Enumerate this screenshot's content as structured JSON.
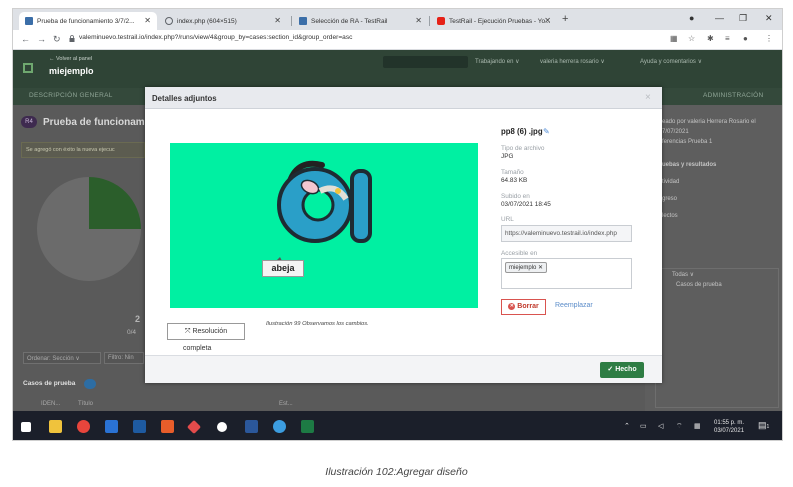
{
  "browser": {
    "tabs": [
      {
        "title": "Prueba de funcionamiento 3/7/2...",
        "favicon_color": "#3b6ea8"
      },
      {
        "title": "index.php (604×515)",
        "favicon_color": "#5f6368"
      },
      {
        "title": "Selección de RA - TestRail",
        "favicon_color": "#3b6ea8"
      },
      {
        "title": "TestRail - Ejecución Pruebas - Yo...",
        "favicon_color": "#e62117"
      }
    ],
    "new_tab": "+",
    "url": "valeminuevo.testrail.io/index.php?/runs/view/4&group_by=cases:section_id&group_order=asc"
  },
  "app": {
    "back_link": "← Volver al panel",
    "project": "miejemplo",
    "header_items": [
      "Trabajando en ∨",
      "valeria herrera rosario ∨",
      "Ayuda y comentarios ∨"
    ],
    "nav": [
      "DESCRIPCIÓN GENERAL",
      "ADMINISTRACIÓN"
    ],
    "run_title": "Prueba de funcionam",
    "run_badge": "R4",
    "success_msg": "Se agregó con éxito la nueva ejecuc",
    "pie_number": "2",
    "pie_sub": "0/4",
    "ordenar": "Ordenar: Sección ∨",
    "filtro": "Filtro: Nin",
    "cases_title": "Casos de prueba",
    "col_id": "IDEN...",
    "col_title": "Título",
    "col_est": "Est...",
    "right_text": [
      "eado por valeria Herrera Rosario el",
      "7/07/2021",
      "ferencias Prueba 1"
    ],
    "right_heading": "uebas y resultados",
    "right_links": [
      "tividad",
      "greso",
      "lectos"
    ],
    "tree_label": "Todas ∨",
    "tree_item": "Casos de prueba"
  },
  "modal": {
    "title": "Detalles adjuntos",
    "close": "×",
    "image_label": "abeja",
    "resolution_button": "Resolución",
    "resolution_second_line": "completa",
    "caption": "Ilustración 99 Observamos los cambios.",
    "filename": "pp8 (6) .jpg",
    "file_type_label": "Tipo de archivo",
    "file_type": "JPG",
    "size_label": "Tamaño",
    "size": "64.83 KB",
    "uploaded_label": "Subido en",
    "uploaded": "03/07/2021 18:45",
    "url_label": "URL",
    "url": "https://valeminuevo.testrail.io/index.php",
    "access_label": "Accesible en",
    "access_chip": "miejemplo",
    "delete_button": "Borrar",
    "replace_link": "Reemplazar",
    "done_button": "Hecho"
  },
  "taskbar": {
    "time": "01:55 p. m.",
    "date": "03/07/2021",
    "notifications": "1"
  },
  "figure_caption": "Ilustración 102:Agregar diseño"
}
